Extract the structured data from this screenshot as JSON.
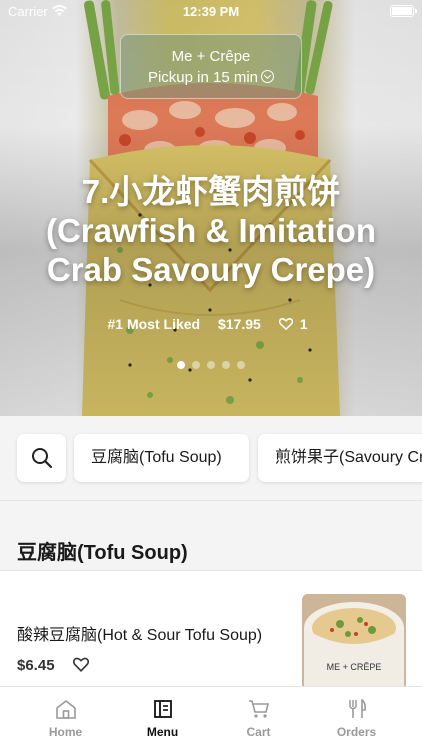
{
  "status": {
    "carrier": "Carrier",
    "time": "12:39 PM"
  },
  "pickup": {
    "store": "Me + Crêpe",
    "time": "Pickup in 15 min"
  },
  "hero": {
    "title": "7.小龙虾蟹肉煎饼(Crawfish & Imitation Crab Savoury Crepe)",
    "badge": "#1 Most Liked",
    "price": "$17.95",
    "likes": "1",
    "carousel": {
      "pages": 5,
      "active_index": 0
    }
  },
  "categories": [
    {
      "label": "豆腐脑(Tofu Soup)"
    },
    {
      "label": "煎饼果子(Savoury Crepe)"
    }
  ],
  "section": {
    "title": "豆腐脑(Tofu Soup)"
  },
  "items": [
    {
      "name": "酸辣豆腐脑(Hot & Sour Tofu Soup)",
      "price": "$6.45",
      "cup_text": "ME + CRÊPE"
    }
  ],
  "tabs": [
    {
      "label": "Home",
      "icon": "home-icon",
      "active": false
    },
    {
      "label": "Menu",
      "icon": "menu-icon",
      "active": true
    },
    {
      "label": "Cart",
      "icon": "cart-icon",
      "active": false
    },
    {
      "label": "Orders",
      "icon": "orders-icon",
      "active": false
    }
  ]
}
